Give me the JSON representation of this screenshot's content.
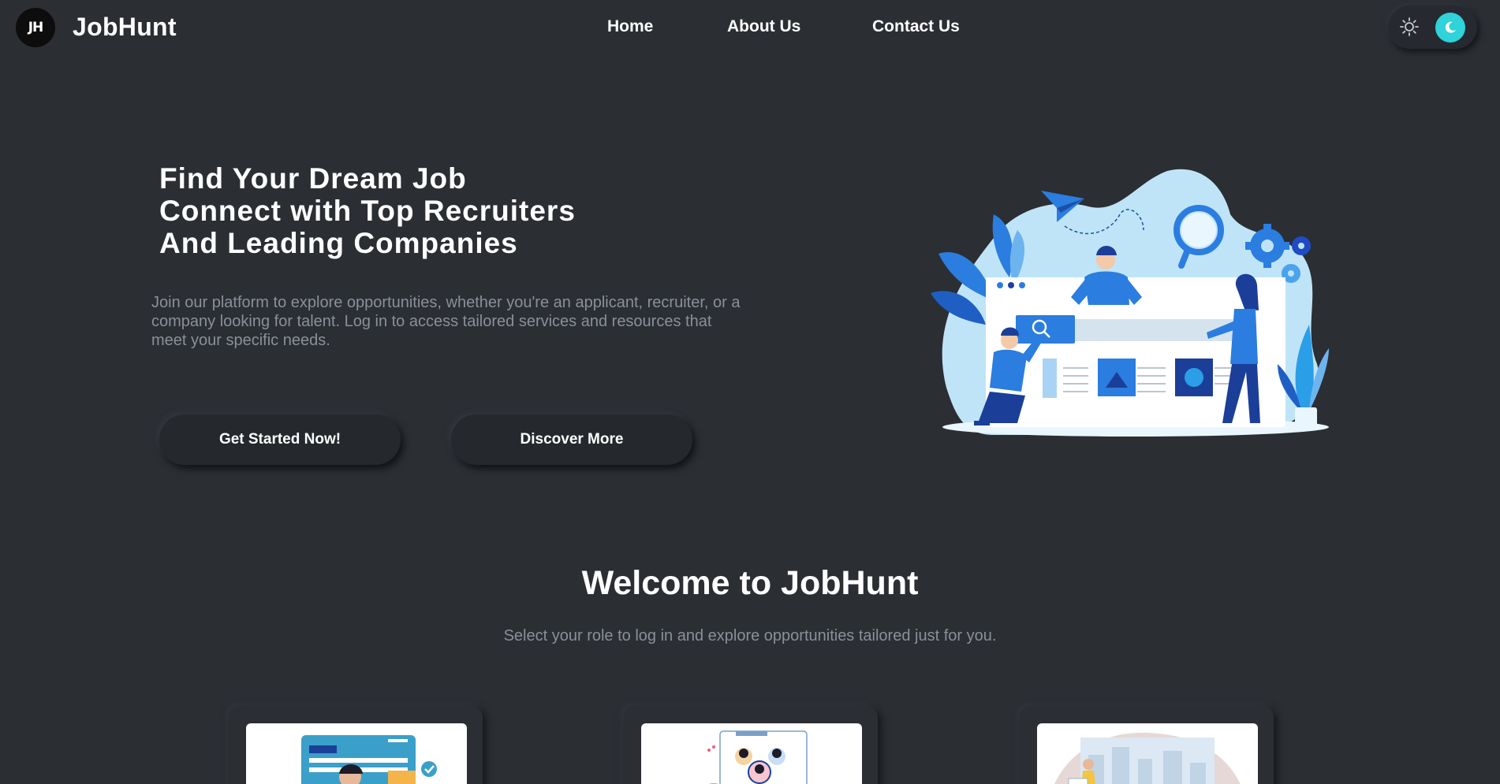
{
  "brand": {
    "logo_text": "JH",
    "name": "JobHunt"
  },
  "nav": {
    "items": [
      {
        "label": "Home"
      },
      {
        "label": "About Us"
      },
      {
        "label": "Contact Us"
      }
    ]
  },
  "theme_toggle": {
    "active": "dark",
    "accent": "#2fd3d9"
  },
  "hero": {
    "title_lines": [
      "Find Your Dream Job",
      "Connect with Top Recruiters",
      "And Leading Companies"
    ],
    "description": "Join our platform to explore opportunities, whether you're an applicant, recruiter, or a company looking for talent. Log in to access tailored services and resources that meet your specific needs.",
    "primary_button": "Get Started Now!",
    "secondary_button": "Discover More"
  },
  "welcome": {
    "title": "Welcome to JobHunt",
    "subtitle": "Select your role to log in and explore opportunities tailored just for you."
  },
  "colors": {
    "background": "#2b2e33",
    "muted_text": "#8a9099",
    "illustration_blue": "#2b7de0"
  }
}
